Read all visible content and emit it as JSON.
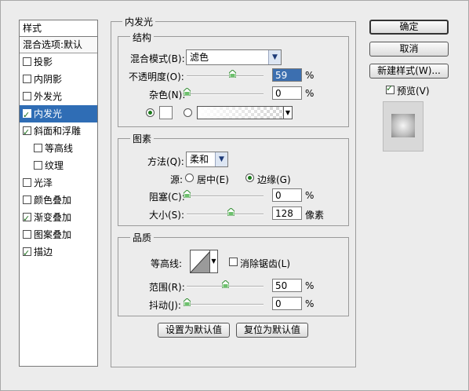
{
  "style_list": {
    "header": "样式",
    "blending": "混合选项:默认",
    "items": [
      {
        "label": "投影",
        "checked": false,
        "indent": false,
        "active": false
      },
      {
        "label": "内阴影",
        "checked": false,
        "indent": false,
        "active": false
      },
      {
        "label": "外发光",
        "checked": false,
        "indent": false,
        "active": false
      },
      {
        "label": "内发光",
        "checked": true,
        "indent": false,
        "active": true
      },
      {
        "label": "斜面和浮雕",
        "checked": true,
        "indent": false,
        "active": false
      },
      {
        "label": "等高线",
        "checked": false,
        "indent": true,
        "active": false
      },
      {
        "label": "纹理",
        "checked": false,
        "indent": true,
        "active": false
      },
      {
        "label": "光泽",
        "checked": false,
        "indent": false,
        "active": false
      },
      {
        "label": "颜色叠加",
        "checked": false,
        "indent": false,
        "active": false
      },
      {
        "label": "渐变叠加",
        "checked": true,
        "indent": false,
        "active": false
      },
      {
        "label": "图案叠加",
        "checked": false,
        "indent": false,
        "active": false
      },
      {
        "label": "描边",
        "checked": true,
        "indent": false,
        "active": false
      }
    ]
  },
  "panel_title": "内发光",
  "structure": {
    "title": "结构",
    "blend_mode_label": "混合模式(B):",
    "blend_mode_value": "滤色",
    "opacity_label": "不透明度(O):",
    "opacity_value": "59",
    "opacity_level": 59,
    "noise_label": "杂色(N):",
    "noise_value": "0",
    "noise_level": 0,
    "percent": "%"
  },
  "elements": {
    "title": "图素",
    "technique_label": "方法(Q):",
    "technique_value": "柔和",
    "source_label": "源:",
    "source_center": "居中(E)",
    "source_edge": "边缘(G)",
    "choke_label": "阻塞(C):",
    "choke_value": "0",
    "choke_level": 0,
    "size_label": "大小(S):",
    "size_value": "128",
    "size_unit": "像素",
    "percent": "%"
  },
  "quality": {
    "title": "品质",
    "contour_label": "等高线:",
    "antialias_label": "消除锯齿(L)",
    "range_label": "范围(R):",
    "range_value": "50",
    "range_level": 50,
    "jitter_label": "抖动(J):",
    "jitter_value": "0",
    "jitter_level": 0,
    "percent": "%"
  },
  "buttons": {
    "make_default": "设置为默认值",
    "reset_default": "复位为默认值",
    "ok": "确定",
    "cancel": "取消",
    "new_style": "新建样式(W)...",
    "preview": "预览(V)"
  },
  "colors": {
    "accent": "#2f6db5",
    "selected_input": "#3c6fb0"
  }
}
